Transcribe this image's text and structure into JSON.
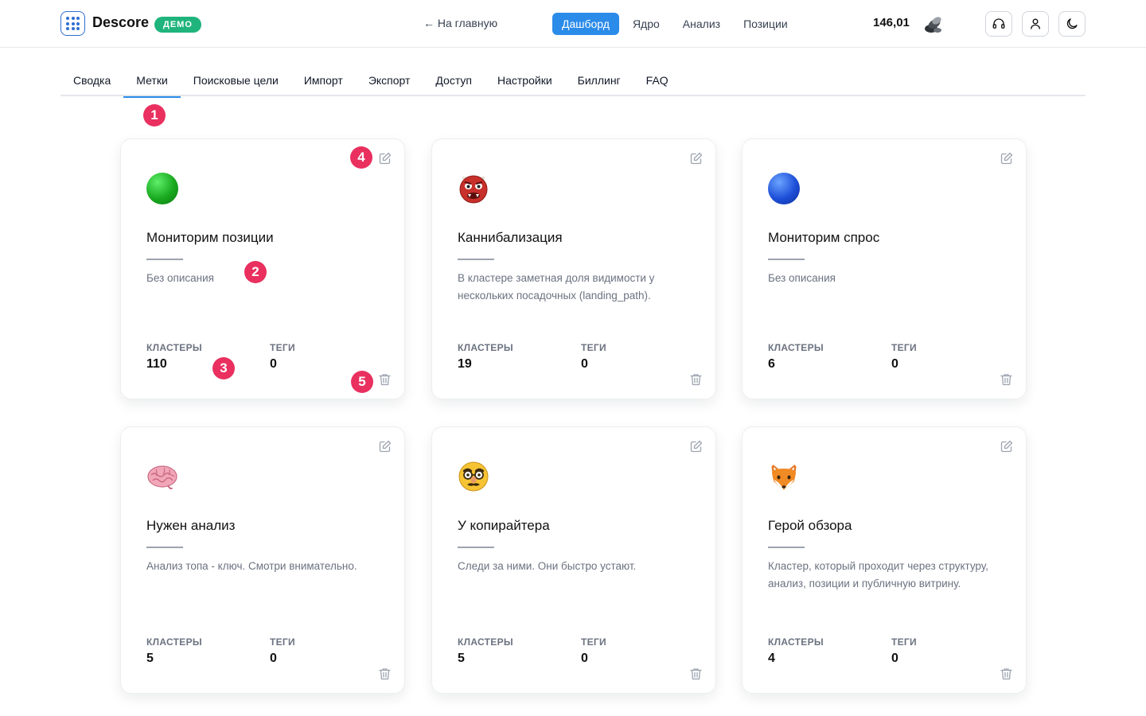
{
  "header": {
    "brand": "Descore",
    "badge": "ДЕМО",
    "back_link": "← На главную",
    "nav": [
      "Дашборд",
      "Ядро",
      "Анализ",
      "Позиции"
    ],
    "balance": "146,01",
    "icons": [
      "support-headset-icon",
      "user-icon",
      "dark-mode-moon-icon"
    ]
  },
  "tabs": [
    "Сводка",
    "Метки",
    "Поисковые цели",
    "Импорт",
    "Экспорт",
    "Доступ",
    "Настройки",
    "Биллинг",
    "FAQ"
  ],
  "labels": {
    "clusters": "КЛАСТЕРЫ",
    "tags": "ТЕГИ"
  },
  "cards": [
    {
      "title": "Мониторим позиции",
      "description": "Без описания",
      "clusters": "110",
      "tags": "0",
      "icon": "green-circle",
      "color": "#22c55e"
    },
    {
      "title": "Каннибализация",
      "description": "В кластере заметная доля видимости у нескольких посадочных (landing_path).",
      "clusters": "19",
      "tags": "0",
      "icon": "ogre-mask"
    },
    {
      "title": "Мониторим спрос",
      "description": "Без описания",
      "clusters": "6",
      "tags": "0",
      "icon": "blue-circle",
      "color": "#1d4ed8"
    },
    {
      "title": "Нужен анализ",
      "description": "Анализ топа - ключ. Смотри внимательно.",
      "clusters": "5",
      "tags": "0",
      "icon": "brain"
    },
    {
      "title": "У копирайтера",
      "description": "Следи за ними. Они быстро устают.",
      "clusters": "5",
      "tags": "0",
      "icon": "disguised-face"
    },
    {
      "title": "Герой обзора",
      "description": "Кластер, который проходит через структуру, анализ, позиции и публичную витрину.",
      "clusters": "4",
      "tags": "0",
      "icon": "fox"
    }
  ],
  "markers": [
    "1",
    "2",
    "3",
    "4",
    "5"
  ]
}
